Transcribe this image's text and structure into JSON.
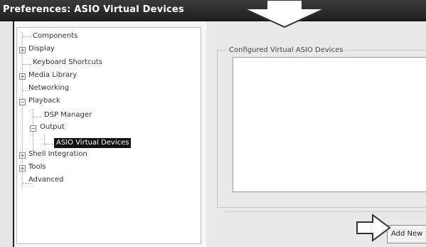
{
  "window": {
    "title": "Preferences: ASIO Virtual Devices"
  },
  "tree": {
    "items": [
      {
        "label": "Components"
      },
      {
        "label": "Display"
      },
      {
        "label": "Keyboard Shortcuts"
      },
      {
        "label": "Media Library"
      },
      {
        "label": "Networking"
      },
      {
        "label": "Playback"
      },
      {
        "label": "DSP Manager"
      },
      {
        "label": "Output"
      },
      {
        "label": "ASIO Virtual Devices",
        "selected": true
      },
      {
        "label": "Shell Integration"
      },
      {
        "label": "Tools"
      },
      {
        "label": "Advanced"
      }
    ],
    "expander_collapsed": "+",
    "expander_expanded": "−"
  },
  "main": {
    "group_label": "Configured Virtual ASIO Devices",
    "add_button_label": "Add New"
  },
  "icons": {
    "callout_down": "down-arrow-callout-icon",
    "callout_right": "right-arrow-callout-icon"
  }
}
